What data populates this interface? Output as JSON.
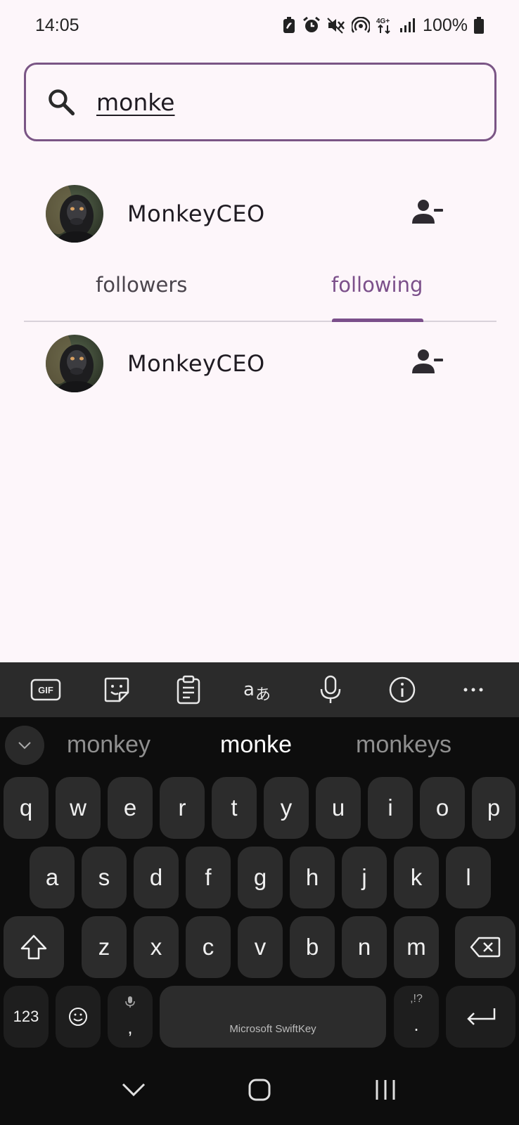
{
  "status_bar": {
    "time": "14:05",
    "battery": "100%",
    "icons": [
      "battery-saver-icon",
      "alarm-icon",
      "mute-icon",
      "hotspot-icon",
      "4g-plus-icon",
      "signal-icon",
      "battery-icon"
    ],
    "network_label": "4G+"
  },
  "search": {
    "value": "monke",
    "icon": "search-icon"
  },
  "profile": {
    "username": "MonkeyCEO",
    "action_icon": "person-remove-icon"
  },
  "tabs": {
    "items": [
      {
        "label": "followers",
        "selected": false
      },
      {
        "label": "following",
        "selected": true
      }
    ],
    "accent_color": "#7b4f8a"
  },
  "list": {
    "items": [
      {
        "username": "MonkeyCEO",
        "action_icon": "person-remove-icon"
      }
    ]
  },
  "keyboard": {
    "toolbar": [
      "gif-icon",
      "sticker-icon",
      "clipboard-icon",
      "translate-icon",
      "mic-icon",
      "info-icon",
      "more-icon"
    ],
    "gif_label": "GIF",
    "suggestions": [
      "monkey",
      "monke",
      "monkeys"
    ],
    "row1": [
      "q",
      "w",
      "e",
      "r",
      "t",
      "y",
      "u",
      "i",
      "o",
      "p"
    ],
    "row2": [
      "a",
      "s",
      "d",
      "f",
      "g",
      "h",
      "j",
      "k",
      "l"
    ],
    "row3": [
      "z",
      "x",
      "c",
      "v",
      "b",
      "n",
      "m"
    ],
    "numbers_key": "123",
    "comma_key": ",",
    "period_key": ".",
    "period_sub": ",!?",
    "space_label": "Microsoft SwiftKey"
  },
  "nav_bar": [
    "hide-keyboard-icon",
    "home-icon",
    "recents-icon"
  ],
  "colors": {
    "background": "#fdf6fa",
    "outline": "#7a5585",
    "keyboard_bg": "#0d0d0d",
    "key_bg": "#2c2c2c"
  }
}
